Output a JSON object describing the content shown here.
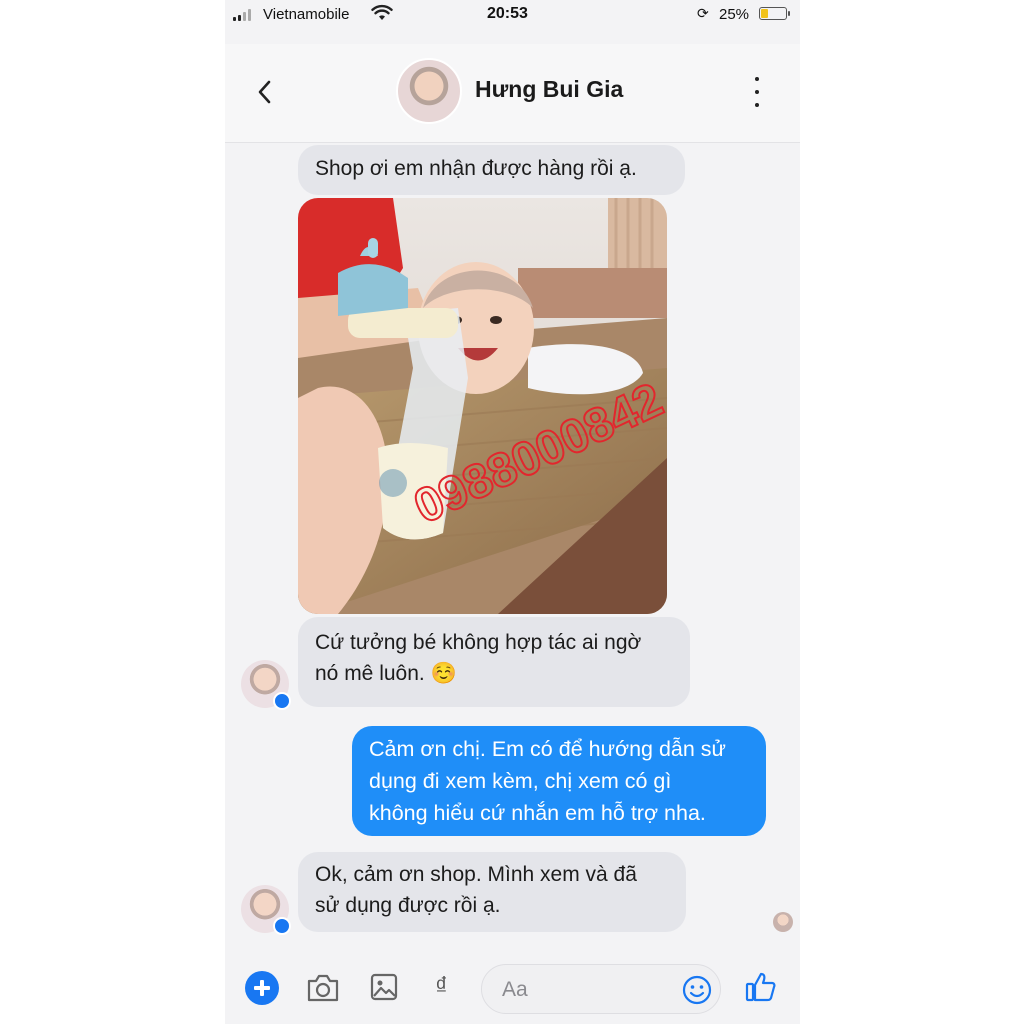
{
  "status_bar": {
    "carrier": "Vietnamobile",
    "time": "20:53",
    "battery": "25%",
    "battery_level": 0.25
  },
  "header": {
    "contact_name": "Hưng Bui Gia"
  },
  "messages": [
    {
      "direction": "incoming",
      "text": "Shop ơi em nhận được hàng rồi ạ."
    },
    {
      "direction": "incoming",
      "type": "image",
      "watermark": "0988000842"
    },
    {
      "direction": "incoming",
      "lines": [
        "Cứ tưởng bé không hợp tác ai ngờ",
        "nó mê luôn. ☺️"
      ]
    },
    {
      "direction": "outgoing",
      "lines": [
        "Cảm ơn chị. Em có để hướng dẫn sử",
        "dụng đi xem kèm, chị xem có gì",
        "không hiểu cứ nhắn em hỗ trợ nha."
      ]
    },
    {
      "direction": "incoming",
      "lines": [
        "Ok, cảm ơn shop. Mình xem và đã",
        "sử dụng được rồi ạ."
      ]
    }
  ],
  "composer": {
    "placeholder": "Aa",
    "currency_symbol": "₫"
  },
  "colors": {
    "accent": "#1877f2",
    "outgoing_bubble": "#1f8ef8",
    "incoming_bubble": "#e4e5ea"
  }
}
